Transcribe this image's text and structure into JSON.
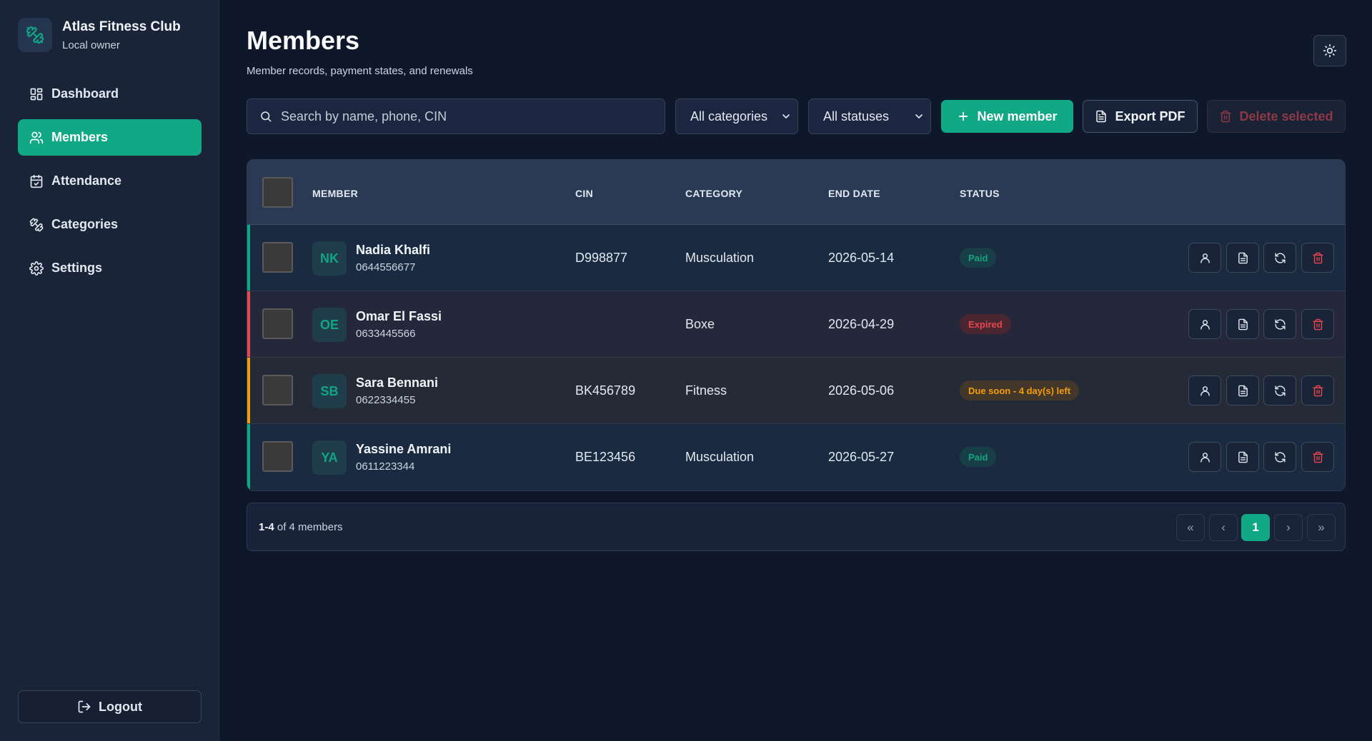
{
  "brand": {
    "name": "Atlas Fitness Club",
    "subtitle": "Local owner"
  },
  "nav": [
    {
      "label": "Dashboard",
      "icon": "dashboard-icon",
      "active": false
    },
    {
      "label": "Members",
      "icon": "users-icon",
      "active": true
    },
    {
      "label": "Attendance",
      "icon": "calendar-check-icon",
      "active": false
    },
    {
      "label": "Categories",
      "icon": "dumbbell-icon",
      "active": false
    },
    {
      "label": "Settings",
      "icon": "gear-icon",
      "active": false
    }
  ],
  "logout_label": "Logout",
  "header": {
    "title": "Members",
    "subtitle": "Member records, payment states, and renewals"
  },
  "toolbar": {
    "search_placeholder": "Search by name, phone, CIN",
    "category_filter": "All categories",
    "status_filter": "All statuses",
    "new_member_label": "New member",
    "export_label": "Export PDF",
    "delete_label": "Delete selected"
  },
  "table": {
    "columns": [
      "MEMBER",
      "CIN",
      "CATEGORY",
      "END DATE",
      "STATUS"
    ],
    "rows": [
      {
        "initials": "NK",
        "name": "Nadia Khalfi",
        "phone": "0644556677",
        "cin": "D998877",
        "category": "Musculation",
        "end_date": "2026-05-14",
        "status": "Paid",
        "status_type": "paid",
        "stripe": "#11a886"
      },
      {
        "initials": "OE",
        "name": "Omar El Fassi",
        "phone": "0633445566",
        "cin": "",
        "category": "Boxe",
        "end_date": "2026-04-29",
        "status": "Expired",
        "status_type": "expired",
        "stripe": "#e8474f"
      },
      {
        "initials": "SB",
        "name": "Sara Bennani",
        "phone": "0622334455",
        "cin": "BK456789",
        "category": "Fitness",
        "end_date": "2026-05-06",
        "status": "Due soon - 4 day(s) left",
        "status_type": "soon",
        "stripe": "#f59e0b"
      },
      {
        "initials": "YA",
        "name": "Yassine Amrani",
        "phone": "0611223344",
        "cin": "BE123456",
        "category": "Musculation",
        "end_date": "2026-05-27",
        "status": "Paid",
        "status_type": "paid",
        "stripe": "#11a886"
      }
    ]
  },
  "pagination": {
    "range": "1-4",
    "suffix": "of 4 members",
    "current_page": "1",
    "first": "«",
    "prev": "‹",
    "next": "›",
    "last": "»"
  },
  "colors": {
    "accent": "#11a886",
    "background": "#0f172b",
    "sidebar": "#1a2438",
    "danger": "#e8474f",
    "warning": "#f59e0b"
  }
}
